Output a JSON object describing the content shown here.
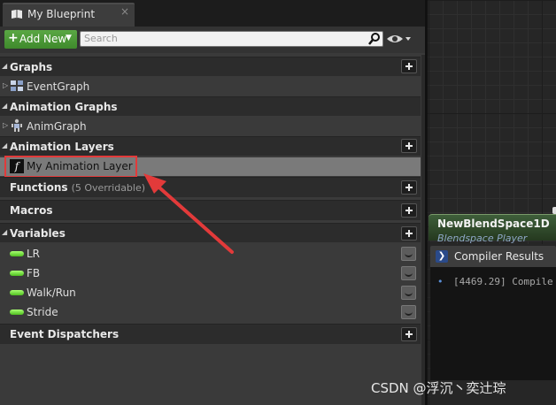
{
  "tab": {
    "title": "My Blueprint",
    "close": "×"
  },
  "toolbar": {
    "add_new_label": "Add New",
    "search_placeholder": "Search"
  },
  "categories": {
    "graphs": "Graphs",
    "animation_graphs": "Animation Graphs",
    "animation_layers": "Animation Layers",
    "functions": "Functions",
    "functions_sub": "(5 Overridable)",
    "macros": "Macros",
    "variables": "Variables",
    "event_dispatchers": "Event Dispatchers"
  },
  "items": {
    "event_graph": "EventGraph",
    "anim_graph": "AnimGraph",
    "animation_layer": "My Animation Layer",
    "variables": [
      "LR",
      "FB",
      "Walk/Run",
      "Stride"
    ]
  },
  "graph": {
    "node_title": "NewBlendSpace1D",
    "node_subtitle": "Blendspace Player"
  },
  "compiler": {
    "tab_label": "Compiler Results",
    "message": "[4469.29] Compile"
  },
  "watermark": "CSDN @浮沉丶奕辻琮",
  "colors": {
    "add_new_green": "#4a9a35",
    "variable_pill": "#7fe040",
    "highlight": "#e23a3a",
    "annotation_arrow": "#e23a3a"
  }
}
